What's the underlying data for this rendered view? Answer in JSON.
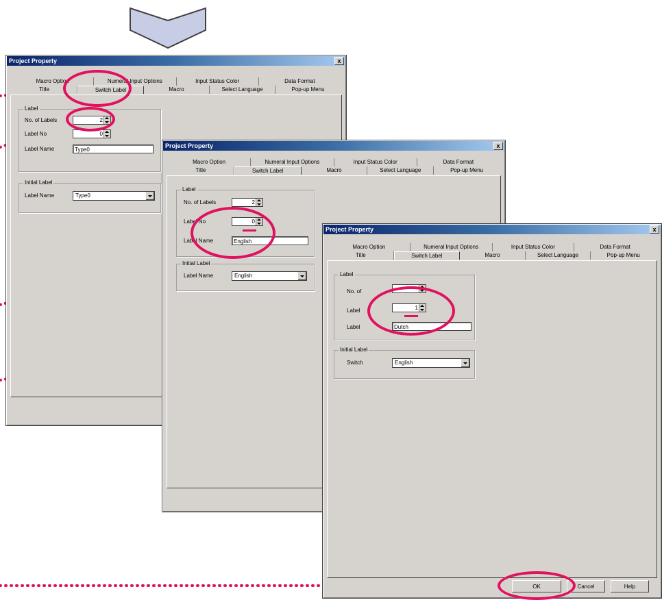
{
  "dialog1": {
    "title": "Project Property",
    "close": "x",
    "tabs_top": [
      "Macro Option",
      "Numeral Input Options",
      "Input Status Color",
      "Data Format"
    ],
    "tabs_bottom": [
      "Title",
      "Switch Label",
      "Macro",
      "Select Language",
      "Pop-up Menu"
    ],
    "label_group": "Label",
    "no_of_labels_label": "No. of Labels",
    "no_of_labels_value": "2",
    "label_no_label": "Label No",
    "label_no_value": "0",
    "label_name_label": "Label Name",
    "label_name_value": "Type0",
    "initial_group": "Initial Label",
    "initial_label_name_label": "Label Name",
    "initial_label_name_value": "Type0"
  },
  "dialog2": {
    "title": "Project Property",
    "close": "x",
    "tabs_top": [
      "Macro Option",
      "Numeral Input Options",
      "Input Status Color",
      "Data Format"
    ],
    "tabs_bottom": [
      "Title",
      "Switch Label",
      "Macro",
      "Select Language",
      "Pop-up Menu"
    ],
    "label_group": "Label",
    "no_of_labels_label": "No. of Labels",
    "no_of_labels_value": "2",
    "label_no_label": "Label No",
    "label_no_value": "0",
    "label_name_label": "Label Name",
    "label_name_value": "English",
    "initial_group": "Initial Label",
    "initial_label_name_label": "Label Name",
    "initial_label_name_value": "English"
  },
  "dialog3": {
    "title": "Project Property",
    "close": "x",
    "tabs_top": [
      "Macro Option",
      "Numeral Input Options",
      "Input Status Color",
      "Data Format"
    ],
    "tabs_bottom": [
      "Title",
      "Switch Label",
      "Macro",
      "Select Language",
      "Pop-up Menu"
    ],
    "label_group": "Label",
    "no_of_labels_label": "No. of",
    "label_no_label": "Label",
    "label_no_value": "1",
    "label_name_label": "Label",
    "label_name_value": "Dutch",
    "initial_group": "Initial Label",
    "switch_label": "Switch",
    "switch_value": "English",
    "ok": "OK",
    "cancel": "Cancel",
    "help": "Help"
  },
  "colors": {
    "highlight": "#e0115f",
    "arrow": "#c8cde6"
  }
}
